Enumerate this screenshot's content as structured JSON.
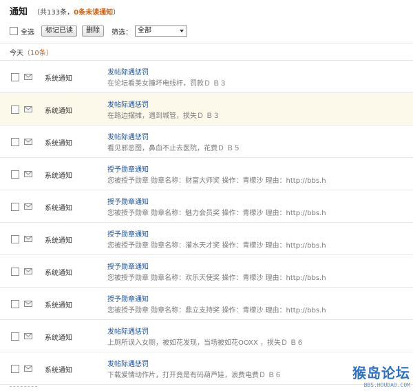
{
  "header": {
    "title": "通知",
    "meta_prefix": "（共133条，",
    "unread": "0条未读通知",
    "meta_suffix": "）"
  },
  "toolbar": {
    "select_all_label": "全选",
    "mark_read_label": "标记已读",
    "delete_label": "删除",
    "filter_label": "筛选：",
    "filter_value": "全部"
  },
  "section": {
    "label": "今天",
    "count": "（10条）"
  },
  "notifications": [
    {
      "sender": "系统通知",
      "subject": "发帖际遇惩罚",
      "summary": "在论坛看美女撞坏电线杆，罚款Ｄ Ｂ３"
    },
    {
      "sender": "系统通知",
      "subject": "发帖际遇惩罚",
      "summary": "在路边摆摊，遇到城管，损失Ｄ Ｂ３"
    },
    {
      "sender": "系统通知",
      "subject": "发帖际遇惩罚",
      "summary": "看见邪恶图，鼻血不止去医院，花费Ｄ Ｂ５"
    },
    {
      "sender": "系统通知",
      "subject": "授予勋章通知",
      "summary": "您被授予勋章 勋章名称：财富大师奖 操作：青檬沙 理由：http://bbs.h"
    },
    {
      "sender": "系统通知",
      "subject": "授予勋章通知",
      "summary": "您被授予勋章 勋章名称：魅力会员奖 操作：青檬沙 理由：http://bbs.h"
    },
    {
      "sender": "系统通知",
      "subject": "授予勋章通知",
      "summary": "您被授予勋章 勋章名称：灌水天才奖 操作：青檬沙 理由：http://bbs.h"
    },
    {
      "sender": "系统通知",
      "subject": "授予勋章通知",
      "summary": "您被授予勋章 勋章名称：欢乐天使奖 操作：青檬沙 理由：http://bbs.h"
    },
    {
      "sender": "系统通知",
      "subject": "授予勋章通知",
      "summary": "您被授予勋章 勋章名称：鼎立支持奖 操作：青檬沙 理由：http://bbs.h"
    },
    {
      "sender": "系统通知",
      "subject": "发帖际遇惩罚",
      "summary": "上厕所误入女厕，被如花发现，当场被如花OOXX ，损失Ｄ Ｂ６"
    },
    {
      "sender": "系统通知",
      "subject": "发帖际遇惩罚",
      "summary": "下载爱情动作片，打开竟是有码葫芦娃，浪费电费Ｄ Ｂ６"
    }
  ],
  "watermark": {
    "main": "猴岛论坛",
    "url": "BBS.HOUDAO.COM"
  },
  "colors": {
    "link": "#1a4e96",
    "accent": "#c8641a",
    "highlight_row": "#fdf9ea"
  },
  "icons": {
    "row_icon": "envelope-icon"
  }
}
